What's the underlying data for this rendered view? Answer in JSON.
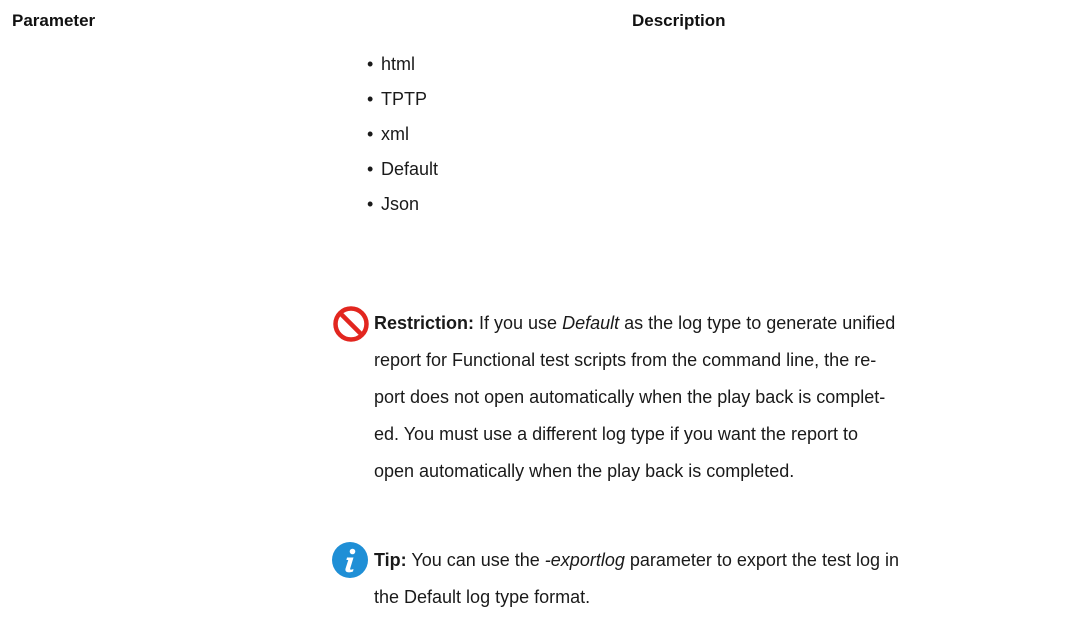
{
  "table": {
    "header_parameter": "Parameter",
    "header_description": "Description"
  },
  "log_types": [
    "html",
    "TPTP",
    "xml",
    "Default",
    "Json"
  ],
  "restriction": {
    "icon": "restriction-icon",
    "icon_color": "#e2261f",
    "label": "Restriction:",
    "lines": [
      {
        "pre": " If you use ",
        "em": "Default",
        "post": " as the log type to generate unified"
      },
      {
        "pre": "report for Functional test scripts from the command line, the re-"
      },
      {
        "pre": "port does not open automatically when the play back is complet-"
      },
      {
        "pre": "ed. You must use a different log type if you want the report to"
      },
      {
        "pre": "open automatically when the play back is completed."
      }
    ]
  },
  "tip": {
    "icon": "info-icon",
    "icon_color": "#1f8fd6",
    "label": "Tip:",
    "lines": [
      {
        "pre": " You can use the ",
        "em": "-exportlog",
        "post": " parameter to export the test log in"
      },
      {
        "pre": "the Default log type format."
      }
    ]
  }
}
